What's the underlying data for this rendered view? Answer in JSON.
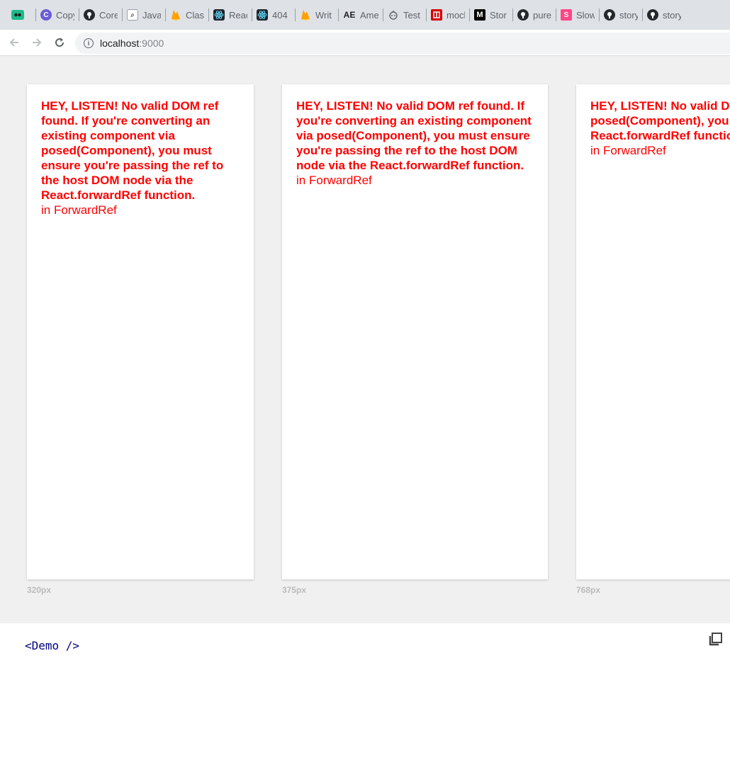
{
  "bookmarks": {
    "items": [
      {
        "label": "Copy",
        "icon": "copy-circle-icon",
        "color": "#6b5bd6"
      },
      {
        "label": "Core",
        "icon": "github-icon",
        "color": "#24292e"
      },
      {
        "label": "Java",
        "icon": "search-square-icon",
        "color": "#9aa0a6"
      },
      {
        "label": "Clas",
        "icon": "firebase-icon",
        "color": "#ffa000"
      },
      {
        "label": "Reac",
        "icon": "react-icon",
        "color": "#20232a"
      },
      {
        "label": "404",
        "icon": "react-icon",
        "color": "#20232a"
      },
      {
        "label": "Writ",
        "icon": "firebase-icon",
        "color": "#ffa000"
      },
      {
        "label": "Ame",
        "icon": "ae-logo-icon",
        "color": "#202124"
      },
      {
        "label": "Test",
        "icon": "robot-icon",
        "color": "#5f6368"
      },
      {
        "label": "mocl",
        "icon": "red-square-icon",
        "color": "#d50000"
      },
      {
        "label": "Stor",
        "icon": "medium-icon",
        "color": "#000000"
      },
      {
        "label": "pure",
        "icon": "github-icon",
        "color": "#24292e"
      },
      {
        "label": "Slow",
        "icon": "storybook-icon",
        "color": "#ff4785"
      },
      {
        "label": "story",
        "icon": "github-icon",
        "color": "#24292e"
      },
      {
        "label": "story",
        "icon": "github-icon",
        "color": "#24292e"
      }
    ]
  },
  "address": {
    "host": "localhost",
    "port": ":9000"
  },
  "frames": [
    {
      "error_title": "HEY, LISTEN! No valid DOM ref found. If you're converting an existing component via posed(Component), you must ensure you're passing the ref to the host DOM node via the React.forwardRef function.",
      "error_sub": "in ForwardRef",
      "label": "320px"
    },
    {
      "error_title": "HEY, LISTEN! No valid DOM ref found. If you're converting an existing component via posed(Component), you must ensure you're passing the ref to the host DOM node via the React.forwardRef function.",
      "error_sub": "in ForwardRef",
      "label": "375px"
    },
    {
      "error_title": "HEY, LISTEN! No valid DOM ref found. If you're converting an existing component via posed(Component), you must ensure you're passing the ref to the host DOM node via the React.forwardRef function.",
      "error_sub": "in ForwardRef",
      "label": "768px"
    }
  ],
  "bottom_panel": {
    "code": "<Demo />"
  }
}
